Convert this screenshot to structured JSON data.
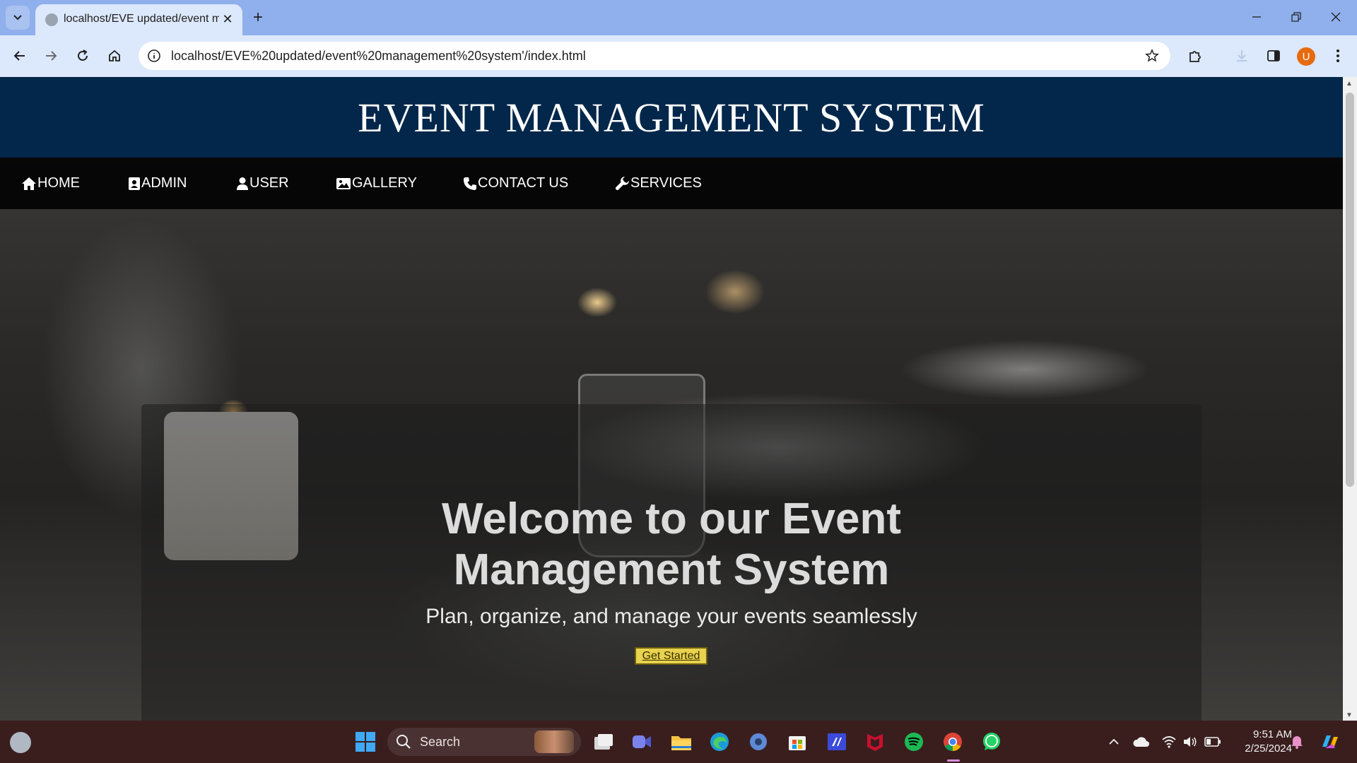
{
  "browser": {
    "tab_title": "localhost/EVE updated/event m",
    "tab_close": "✕",
    "new_tab": "+",
    "url": "localhost/EVE%20updated/event%20management%20system'/index.html",
    "profile_initial": "U",
    "icons": [
      "tab-search-icon",
      "favicon-icon",
      "minimize-icon",
      "restore-icon",
      "close-window-icon",
      "back-icon",
      "forward-icon",
      "reload-icon",
      "home-icon",
      "info-icon",
      "star-icon",
      "extensions-icon",
      "download-icon",
      "side-panel-icon",
      "menu-icon"
    ]
  },
  "site": {
    "title": "EVENT MANAGEMENT SYSTEM",
    "nav": [
      {
        "label": "HOME",
        "icon": "home-icon"
      },
      {
        "label": "ADMIN",
        "icon": "id-card-icon"
      },
      {
        "label": "USER",
        "icon": "user-icon"
      },
      {
        "label": "GALLERY",
        "icon": "image-icon"
      },
      {
        "label": "CONTACT US",
        "icon": "phone-icon"
      },
      {
        "label": "SERVICES",
        "icon": "wrench-icon"
      }
    ],
    "hero": {
      "heading": "Welcome to our Event Management System",
      "subheading": "Plan, organize, and manage your events seamlessly",
      "button": "Get Started"
    }
  },
  "taskbar": {
    "search_label": "Search",
    "time": "9:51 AM",
    "date": "2/25/2024",
    "apps": [
      "start-icon",
      "task-view-icon",
      "meet-icon",
      "file-explorer-icon",
      "edge-icon",
      "settings-icon",
      "store-icon",
      "vscode-icon",
      "mcafee-icon",
      "spotify-icon",
      "chrome-icon",
      "whatsapp-icon"
    ],
    "tray": [
      "chevron-up-icon",
      "onedrive-icon",
      "wifi-icon",
      "volume-icon",
      "battery-icon",
      "notification-icon",
      "copilot-icon"
    ]
  },
  "colors": {
    "header_bg": "#03274b",
    "navbar_bg": "#000000",
    "button_bg": "#e8d24e",
    "chrome_bg": "#dce8fb",
    "taskbar_bg": "#3a1e1e"
  }
}
